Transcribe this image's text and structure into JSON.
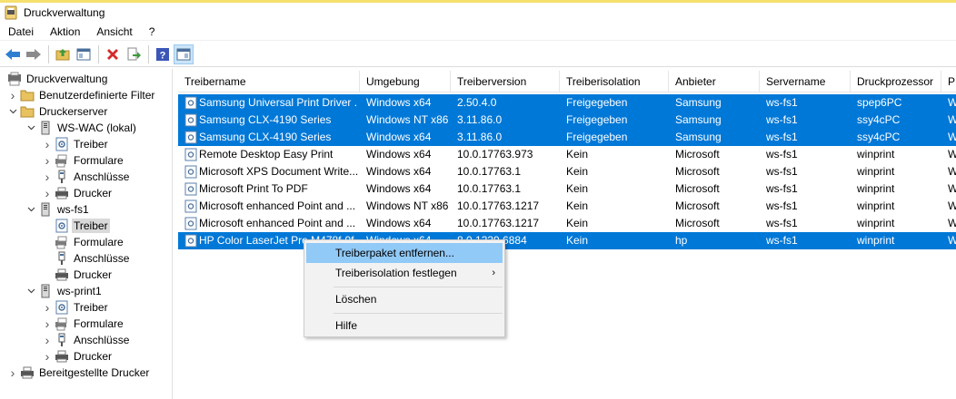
{
  "window": {
    "title": "Druckverwaltung"
  },
  "menu": [
    "Datei",
    "Aktion",
    "Ansicht",
    "?"
  ],
  "toolbar": [
    "back-icon",
    "forward-icon",
    "up-folder-icon",
    "console-tree-icon",
    "delete-icon",
    "export-icon",
    "help-icon",
    "console-icon"
  ],
  "tree": [
    {
      "label": "Druckverwaltung",
      "level": 0,
      "chev": "",
      "icon": "print-management-icon"
    },
    {
      "label": "Benutzerdefinierte Filter",
      "level": 1,
      "chev": ">",
      "icon": "folder-icon"
    },
    {
      "label": "Druckerserver",
      "level": 1,
      "chev": "v",
      "icon": "folder-icon"
    },
    {
      "label": "WS-WAC (lokal)",
      "level": 2,
      "chev": "v",
      "icon": "server-icon"
    },
    {
      "label": "Treiber",
      "level": 3,
      "chev": ">",
      "icon": "driver-icon"
    },
    {
      "label": "Formulare",
      "level": 3,
      "chev": ">",
      "icon": "forms-icon"
    },
    {
      "label": "Anschlüsse",
      "level": 3,
      "chev": ">",
      "icon": "port-icon"
    },
    {
      "label": "Drucker",
      "level": 3,
      "chev": ">",
      "icon": "printer-icon"
    },
    {
      "label": "ws-fs1",
      "level": 2,
      "chev": "v",
      "icon": "server-icon"
    },
    {
      "label": "Treiber",
      "level": 3,
      "chev": "",
      "icon": "driver-icon",
      "selected": true
    },
    {
      "label": "Formulare",
      "level": 3,
      "chev": "",
      "icon": "forms-icon"
    },
    {
      "label": "Anschlüsse",
      "level": 3,
      "chev": "",
      "icon": "port-icon"
    },
    {
      "label": "Drucker",
      "level": 3,
      "chev": "",
      "icon": "printer-icon"
    },
    {
      "label": "ws-print1",
      "level": 2,
      "chev": "v",
      "icon": "server-icon"
    },
    {
      "label": "Treiber",
      "level": 3,
      "chev": ">",
      "icon": "driver-icon"
    },
    {
      "label": "Formulare",
      "level": 3,
      "chev": ">",
      "icon": "forms-icon"
    },
    {
      "label": "Anschlüsse",
      "level": 3,
      "chev": ">",
      "icon": "port-icon"
    },
    {
      "label": "Drucker",
      "level": 3,
      "chev": ">",
      "icon": "printer-icon"
    },
    {
      "label": "Bereitgestellte Drucker",
      "level": 1,
      "chev": ">",
      "icon": "printer-icon"
    }
  ],
  "columns": [
    "Treibername",
    "Umgebung",
    "Treiberversion",
    "Treiberisolation",
    "Anbieter",
    "Servername",
    "Druckprozessor",
    "P"
  ],
  "rows": [
    {
      "cells": [
        "Samsung Universal Print Driver ...",
        "Windows x64",
        "2.50.4.0",
        "Freigegeben",
        "Samsung",
        "ws-fs1",
        "spep6PC",
        "W"
      ],
      "selected": true
    },
    {
      "cells": [
        "Samsung CLX-4190 Series",
        "Windows NT x86",
        "3.11.86.0",
        "Freigegeben",
        "Samsung",
        "ws-fs1",
        "ssy4cPC",
        "W"
      ],
      "selected": true
    },
    {
      "cells": [
        "Samsung CLX-4190 Series",
        "Windows x64",
        "3.11.86.0",
        "Freigegeben",
        "Samsung",
        "ws-fs1",
        "ssy4cPC",
        "W"
      ],
      "selected": true
    },
    {
      "cells": [
        "Remote Desktop Easy Print",
        "Windows x64",
        "10.0.17763.973",
        "Kein",
        "Microsoft",
        "ws-fs1",
        "winprint",
        "W"
      ],
      "selected": false
    },
    {
      "cells": [
        "Microsoft XPS Document Write...",
        "Windows x64",
        "10.0.17763.1",
        "Kein",
        "Microsoft",
        "ws-fs1",
        "winprint",
        "W"
      ],
      "selected": false
    },
    {
      "cells": [
        "Microsoft Print To PDF",
        "Windows x64",
        "10.0.17763.1",
        "Kein",
        "Microsoft",
        "ws-fs1",
        "winprint",
        "W"
      ],
      "selected": false
    },
    {
      "cells": [
        "Microsoft enhanced Point and ...",
        "Windows NT x86",
        "10.0.17763.1217",
        "Kein",
        "Microsoft",
        "ws-fs1",
        "winprint",
        "W"
      ],
      "selected": false
    },
    {
      "cells": [
        "Microsoft enhanced Point and ...",
        "Windows x64",
        "10.0.17763.1217",
        "Kein",
        "Microsoft",
        "ws-fs1",
        "winprint",
        "W"
      ],
      "selected": false
    },
    {
      "cells": [
        "HP Color LaserJet Pro M478f-9f...",
        "Windows x64",
        "8.0.1339.6884",
        "Kein",
        "hp",
        "ws-fs1",
        "winprint",
        "W"
      ],
      "selected": true
    }
  ],
  "context_menu": [
    {
      "label": "Treiberpaket entfernen...",
      "highlighted": true,
      "submenu": false
    },
    {
      "label": "Treiberisolation festlegen",
      "highlighted": false,
      "submenu": true
    },
    {
      "label": "Löschen",
      "highlighted": false,
      "submenu": false
    },
    {
      "label": "Hilfe",
      "highlighted": false,
      "submenu": false
    }
  ],
  "colors": {
    "selection": "#0078d7",
    "menu_highlight": "#91c9f7",
    "tree_selection": "#d9d9d9"
  }
}
